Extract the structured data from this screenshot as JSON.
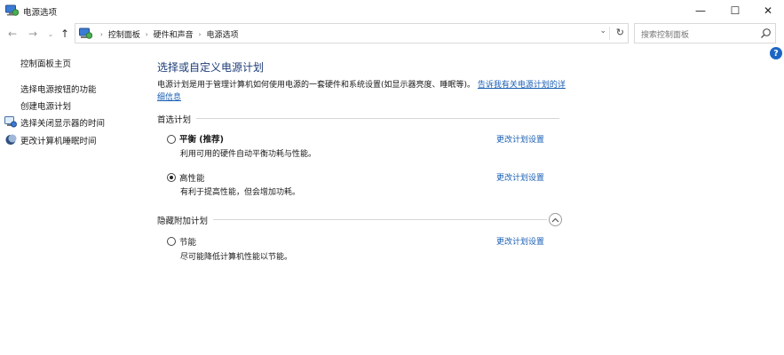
{
  "window": {
    "title": "电源选项",
    "controls": {
      "minimize": "—",
      "maximize": "☐",
      "close": "✕"
    }
  },
  "address": {
    "nav": {
      "back": "←",
      "forward": "→",
      "recent": "⌄",
      "up": "↑"
    },
    "breadcrumbs": [
      "控制面板",
      "硬件和声音",
      "电源选项"
    ],
    "separator": "›",
    "dropdown": "⌄",
    "refresh": "↻",
    "search_placeholder": "搜索控制面板"
  },
  "help": {
    "label": "?"
  },
  "sidebar": {
    "home": "控制面板主页",
    "items": [
      {
        "label": "选择电源按钮的功能",
        "icon": ""
      },
      {
        "label": "创建电源计划",
        "icon": ""
      },
      {
        "label": "选择关闭显示器的时间",
        "icon": "monitor-icon"
      },
      {
        "label": "更改计算机睡眠时间",
        "icon": "moon-icon"
      }
    ]
  },
  "main": {
    "title": "选择或自定义电源计划",
    "description": "电源计划是用于管理计算机如何使用电源的一套硬件和系统设置(如显示器亮度、睡眠等)。",
    "description_link": "告诉我有关电源计划的详细信息",
    "preferred": {
      "heading": "首选计划",
      "plans": [
        {
          "name": "平衡 (推荐)",
          "description": "利用可用的硬件自动平衡功耗与性能。",
          "change": "更改计划设置",
          "selected": false
        },
        {
          "name": "高性能",
          "description": "有利于提高性能，但会增加功耗。",
          "change": "更改计划设置",
          "selected": true
        }
      ]
    },
    "hidden": {
      "heading": "隐藏附加计划",
      "plans": [
        {
          "name": "节能",
          "description": "尽可能降低计算机性能以节能。",
          "change": "更改计划设置",
          "selected": false
        }
      ]
    }
  },
  "colors": {
    "title": "#1e3d78",
    "link": "#1a5fb4",
    "help": "#1c66c3"
  }
}
